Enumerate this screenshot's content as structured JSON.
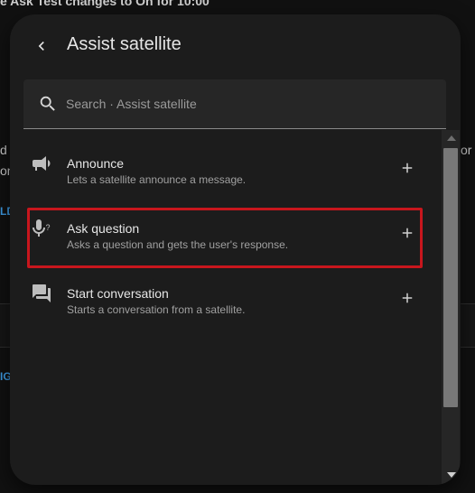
{
  "background": {
    "top_text": "e Ask Test changes to On for 10:00",
    "left_fragment_1": "d",
    "left_fragment_2": "on",
    "left_link_1": "LD",
    "left_link_2": "IG",
    "right_fragment": "or e"
  },
  "dialog": {
    "title": "Assist satellite",
    "search": {
      "placeholder": "Search · Assist satellite",
      "value": ""
    },
    "items": [
      {
        "icon": "megaphone-icon",
        "label": "Announce",
        "description": "Lets a satellite announce a message.",
        "add_icon": "plus-icon"
      },
      {
        "icon": "microphone-question-icon",
        "label": "Ask question",
        "description": "Asks a question and gets the user's response.",
        "add_icon": "plus-icon"
      },
      {
        "icon": "chat-bubbles-icon",
        "label": "Start conversation",
        "description": "Starts a conversation from a satellite.",
        "add_icon": "plus-icon"
      }
    ],
    "highlight_color": "#c8161d"
  }
}
